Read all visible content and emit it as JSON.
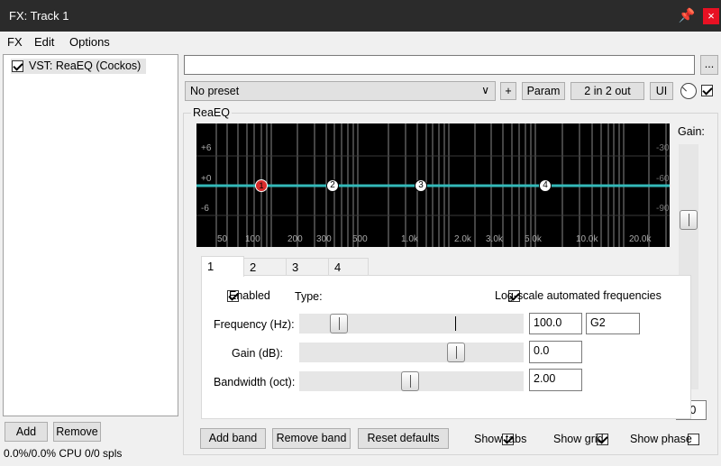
{
  "window": {
    "title": "FX: Track 1",
    "pin_icon": "pin-icon",
    "close_glyph": "×"
  },
  "menu": [
    "FX",
    "Edit",
    "Options"
  ],
  "fx_list": {
    "items": [
      {
        "checked": true,
        "label": "VST: ReaEQ (Cockos)"
      }
    ]
  },
  "left_buttons": {
    "add": "Add",
    "remove": "Remove"
  },
  "status": "0.0%/0.0% CPU 0/0 spls",
  "top_bar": {
    "browse": "...",
    "preset": "No preset",
    "plus": "+",
    "param": "Param",
    "io": "2 in 2 out",
    "ui": "UI",
    "wet_checked": true
  },
  "group_title": "ReaEQ",
  "graph": {
    "db_labels": [
      "+6",
      "+0",
      "-6"
    ],
    "right_labels": [
      "-30",
      "-60",
      "-90"
    ],
    "freq_labels": [
      "50",
      "100",
      "200",
      "300",
      "500",
      "1.0k",
      "2.0k",
      "3.0k",
      "5.0k",
      "10.0k",
      "20.0k"
    ],
    "bands": [
      {
        "label": "1",
        "selected": true
      },
      {
        "label": "2"
      },
      {
        "label": "3"
      },
      {
        "label": "4"
      }
    ],
    "curve_color": "#33b9b9",
    "selected_color": "#d92b2b"
  },
  "tabs": [
    "1",
    "2",
    "3",
    "4"
  ],
  "band": {
    "enabled_label": "Enabled",
    "enabled": true,
    "type_label": "Type:",
    "logscale_label": "Log-scale automated frequencies",
    "logscale": true,
    "frequency_label": "Frequency (Hz):",
    "frequency_value": "100.0",
    "note_value": "G2",
    "gain_label": "Gain (dB):",
    "gain_value": "0.0",
    "bandwidth_label": "Bandwidth (oct):",
    "bandwidth_value": "2.00"
  },
  "gain_panel": {
    "label": "Gain:",
    "value": "0.0"
  },
  "bottom": {
    "add_band": "Add band",
    "remove_band": "Remove band",
    "reset": "Reset defaults",
    "show_tabs": "Show tabs",
    "show_tabs_checked": true,
    "show_grid": "Show grid",
    "show_grid_checked": true,
    "show_phase": "Show phase",
    "show_phase_checked": false
  }
}
